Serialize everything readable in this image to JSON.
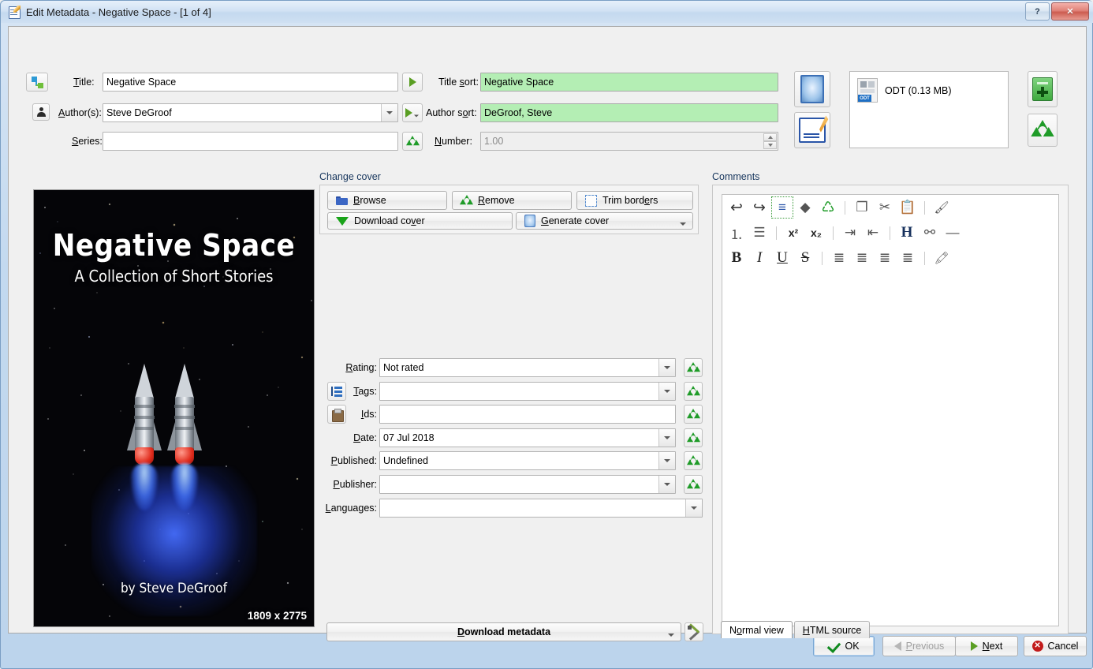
{
  "window": {
    "title": "Edit Metadata - Negative Space -  [1 of 4]",
    "icon": "edit-metadata-icon",
    "help_label": "?",
    "close_label": "✕"
  },
  "form": {
    "title_label": "Title:",
    "title_value": "Negative Space",
    "title_swap_icon": "swap-title-author-icon",
    "title_paste_button": "title-sort-auto-button",
    "title_sort_label": "Title sort:",
    "title_sort_value": "Negative Space",
    "author_icon": "author-icon",
    "author_label": "Author(s):",
    "author_value": "Steve DeGroof",
    "author_sort_button": "author-sort-auto-button",
    "author_sort_label": "Author sort:",
    "author_sort_value": "DeGroof, Steve",
    "series_label": "Series:",
    "series_value": "",
    "series_clear_icon": "recycle-icon",
    "number_label": "Number:",
    "number_value": "1.00"
  },
  "formats": {
    "cover_from_ebook_icon": "cover-from-ebook-icon",
    "edit_metadata_from_format_icon": "metadata-from-format-icon",
    "files": [
      {
        "name": "ODT (0.13 MB)",
        "icon": "odt-file-icon"
      }
    ],
    "add_format_icon": "add-format-icon",
    "remove_format_icon": "remove-format-icon"
  },
  "cover": {
    "title": "Negative Space",
    "subtitle": "A Collection of Short Stories",
    "author": "by Steve DeGroof",
    "dimensions": "1809 x 2775"
  },
  "change_cover": {
    "group_title": "Change cover",
    "browse": "Browse",
    "remove": "Remove",
    "trim_borders": "Trim borders",
    "download_cover": "Download cover",
    "generate_cover": "Generate cover"
  },
  "fields": [
    {
      "label": "Rating:",
      "value": "Not rated",
      "type": "combo",
      "icon": null,
      "clear": true,
      "name": "rating"
    },
    {
      "label": "Tags:",
      "value": "",
      "type": "combo",
      "icon": "tags-icon",
      "clear": true,
      "name": "tags"
    },
    {
      "label": "Ids:",
      "value": "",
      "type": "text",
      "icon": "paste-ids-icon",
      "clear": true,
      "name": "ids"
    },
    {
      "label": "Date:",
      "value": "07 Jul 2018",
      "type": "combo",
      "icon": null,
      "clear": true,
      "name": "date"
    },
    {
      "label": "Published:",
      "value": "Undefined",
      "type": "combo",
      "icon": null,
      "clear": true,
      "name": "published"
    },
    {
      "label": "Publisher:",
      "value": "",
      "type": "combo",
      "icon": null,
      "clear": true,
      "name": "publisher"
    },
    {
      "label": "Languages:",
      "value": "",
      "type": "combo",
      "icon": null,
      "clear": false,
      "name": "languages"
    }
  ],
  "download_metadata": {
    "label": "Download metadata",
    "config_icon": "configure-download-icon"
  },
  "comments": {
    "group_title": "Comments",
    "body": "",
    "toolbar_rows": [
      [
        "undo-icon",
        "redo-icon",
        "align-justify-highlight-icon",
        "eraser-icon",
        "recycle-icon",
        "|",
        "copy-icon",
        "cut-icon",
        "paste-icon",
        "|",
        "color-fill-icon"
      ],
      [
        "ordered-list-icon",
        "unordered-list-icon",
        "|",
        "superscript-icon",
        "subscript-icon",
        "|",
        "indent-icon",
        "outdent-icon",
        "|",
        "heading-icon",
        "link-icon",
        "horizontal-rule-icon"
      ],
      [
        "bold-icon",
        "italic-icon",
        "underline-icon",
        "strikethrough-icon",
        "|",
        "align-left-icon",
        "align-center-icon",
        "align-right-icon",
        "align-justify-icon",
        "|",
        "clear-format-icon"
      ]
    ],
    "tabs": [
      {
        "label": "Normal view",
        "active": true
      },
      {
        "label": "HTML source",
        "active": false
      }
    ]
  },
  "footer": {
    "ok": "OK",
    "previous": "Previous",
    "next": "Next",
    "cancel": "Cancel"
  },
  "colors": {
    "sort_field_green": "#b4eeb4",
    "group_title_blue": "#17365d",
    "recycle_green": "#1f9b28",
    "accent_chevron": "#5a9e23"
  }
}
